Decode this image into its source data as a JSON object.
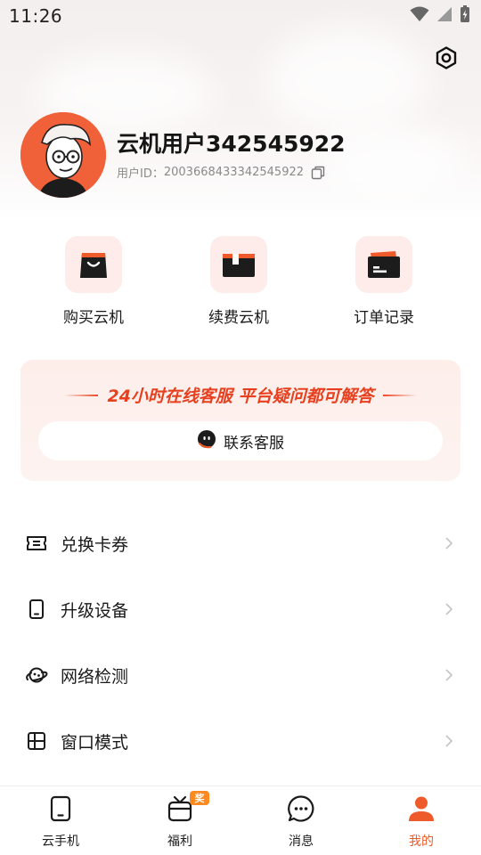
{
  "status_bar": {
    "time": "11:26",
    "icons": [
      "wifi-icon",
      "cell-signal-icon",
      "battery-charging-icon"
    ]
  },
  "header": {
    "settings_icon": "settings-icon"
  },
  "profile": {
    "username": "云机用户342545922",
    "user_id_label": "用户ID：",
    "user_id_value": "2003668433342545922",
    "copy_icon": "copy-icon",
    "avatar_icon": "avatar-illustration"
  },
  "quick_actions": [
    {
      "label": "购买云机",
      "icon": "shopping-bag-icon"
    },
    {
      "label": "续费云机",
      "icon": "renew-box-icon"
    },
    {
      "label": "订单记录",
      "icon": "order-card-icon"
    }
  ],
  "support": {
    "headline": "24小时在线客服 平台疑问都可解答",
    "button_label": "联系客服",
    "button_icon": "chat-bot-icon"
  },
  "menu": [
    {
      "label": "兑换卡券",
      "icon": "ticket-icon"
    },
    {
      "label": "升级设备",
      "icon": "phone-device-icon"
    },
    {
      "label": "网络检测",
      "icon": "planet-icon"
    },
    {
      "label": "窗口模式",
      "icon": "window-grid-icon"
    }
  ],
  "tabs": [
    {
      "label": "云手机",
      "icon": "phone-tab-icon",
      "active": false
    },
    {
      "label": "福利",
      "icon": "gift-tv-icon",
      "badge": "奖",
      "active": false
    },
    {
      "label": "消息",
      "icon": "message-bubble-icon",
      "active": false
    },
    {
      "label": "我的",
      "icon": "profile-person-icon",
      "active": true
    }
  ],
  "colors": {
    "accent": "#ef5a2a",
    "support_text": "#e8401f",
    "badge": "#ff8a1f",
    "icon_bg": "#fdecea"
  }
}
